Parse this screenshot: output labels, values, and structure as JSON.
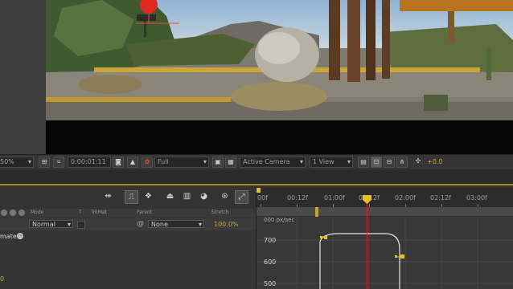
{
  "viewer_toolbar": {
    "zoom": "50%",
    "timecode": "0:00:01:11",
    "resolution": "Full",
    "camera": "Active Camera",
    "views": "1 View",
    "exposure": "+0.0"
  },
  "timeline": {
    "ruler_labels": [
      "00f",
      "00:12f",
      "01:00f",
      "01:12f",
      "02:00f",
      "02:12f",
      "03:00f"
    ],
    "columns": {
      "mode": "Mode",
      "t": "T",
      "trkmat": "TrkMat",
      "parent": "Parent",
      "stretch": "Stretch"
    },
    "layer": {
      "mode": "Normal",
      "parent": "None",
      "stretch": "100.0%"
    },
    "property_label": "mate",
    "graph_header": "000 px/sec",
    "graph_values": [
      "700",
      "600",
      "500"
    ],
    "left_footer": "0"
  },
  "colors": {
    "accent_yellow": "#e8c21e",
    "playhead_red": "#d22222",
    "stretch_orange": "#c9a43a"
  }
}
